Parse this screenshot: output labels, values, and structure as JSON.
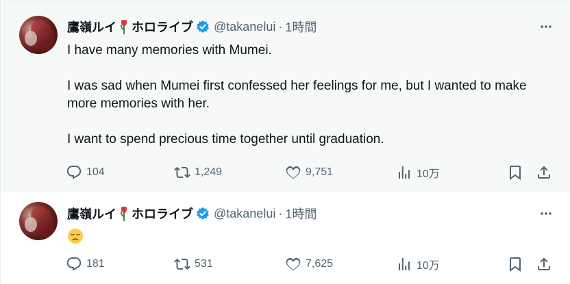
{
  "tweets": [
    {
      "author": {
        "name": "鷹嶺ルイ",
        "name_suffix": "ホロライブ",
        "handle": "@takanelui",
        "time": "1時間"
      },
      "text": [
        "I have many memories with Mumei.",
        "I was sad when Mumei first confessed her feelings for me, but I wanted to make more memories with her.",
        "I want to spend precious time together until graduation."
      ],
      "stats": {
        "replies": "104",
        "reposts": "1,249",
        "likes": "9,751",
        "views": "10万"
      }
    },
    {
      "author": {
        "name": "鷹嶺ルイ",
        "name_suffix": "ホロライブ",
        "handle": "@takanelui",
        "time": "1時間"
      },
      "emoji": "disappointed-face",
      "stats": {
        "replies": "181",
        "reposts": "531",
        "likes": "7,625",
        "views": "10万"
      }
    }
  ],
  "separator": "·",
  "more_label": "···",
  "colors": {
    "verified": "#1d9bf0",
    "muted": "#536471",
    "text": "#0f1419",
    "highlight_bg": "#f7f9f9"
  },
  "icons": [
    "reply-icon",
    "repost-icon",
    "like-icon",
    "views-icon",
    "bookmark-icon",
    "share-icon",
    "more-icon",
    "verified-badge-icon",
    "tulip-icon"
  ]
}
